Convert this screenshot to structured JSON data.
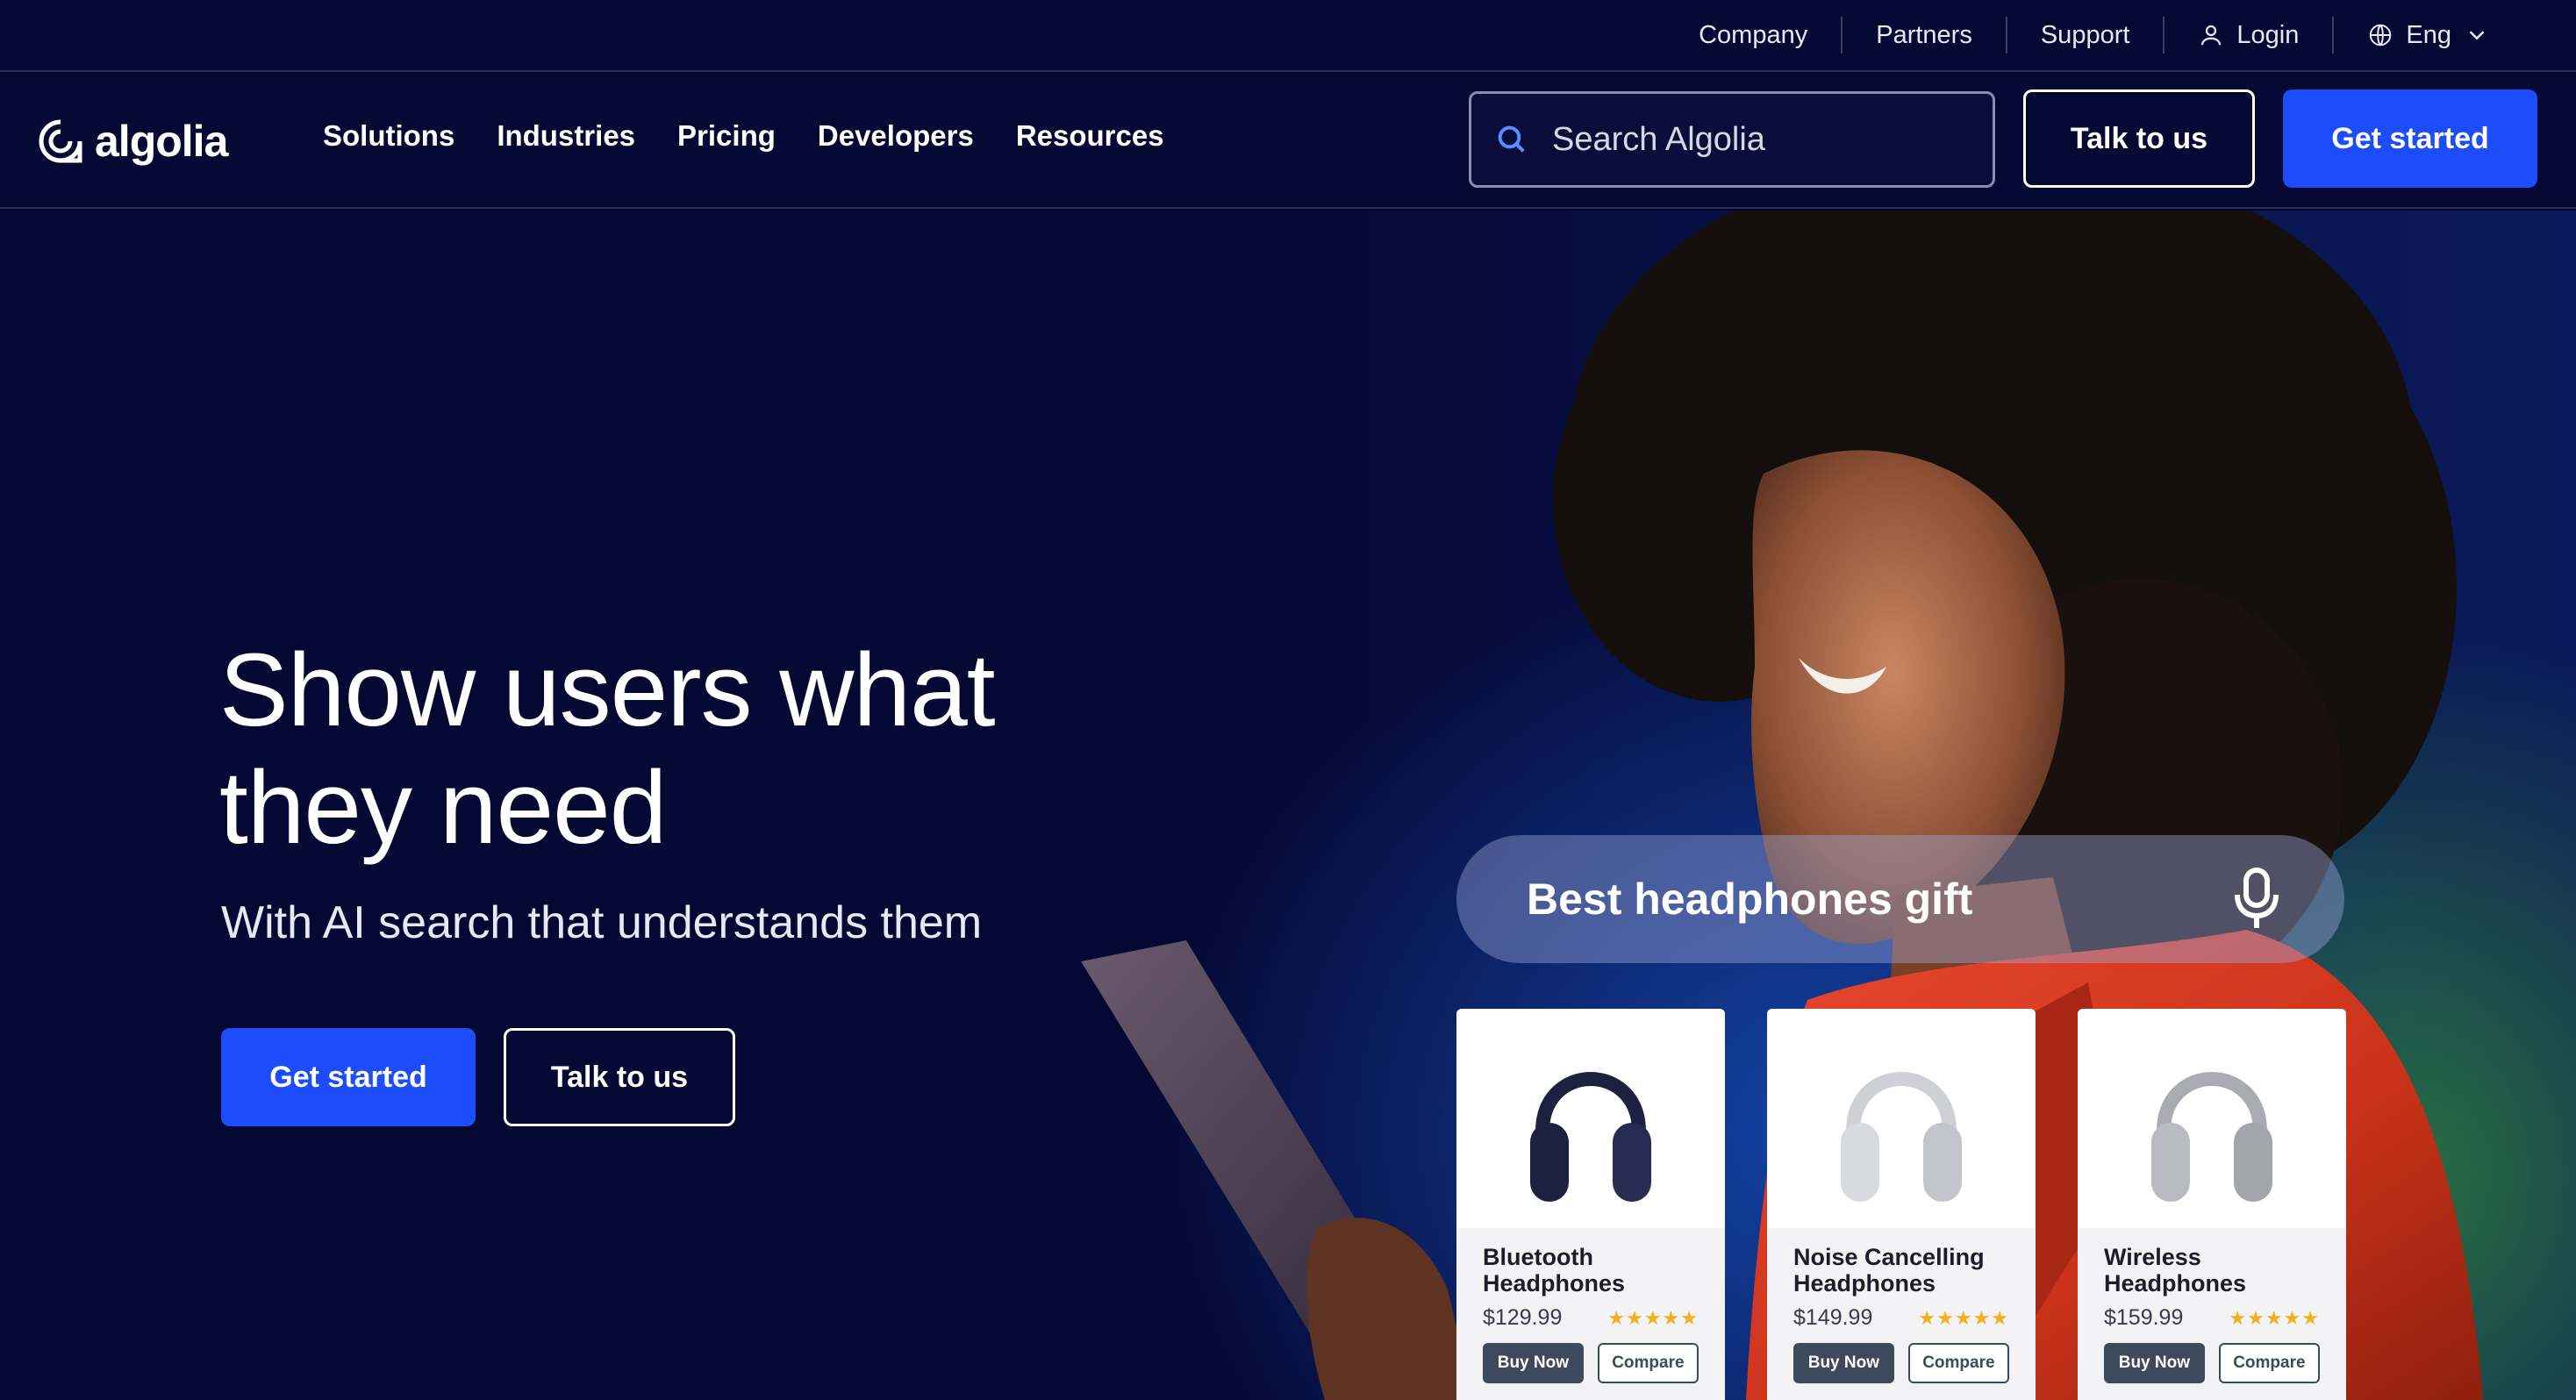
{
  "utility_nav": {
    "company": "Company",
    "partners": "Partners",
    "support": "Support",
    "login": "Login",
    "language": "Eng"
  },
  "brand": {
    "logo_text": "algolia"
  },
  "main_nav": {
    "links": [
      "Solutions",
      "Industries",
      "Pricing",
      "Developers",
      "Resources"
    ],
    "search_placeholder": "Search Algolia",
    "talk_label": "Talk to us",
    "start_label": "Get started"
  },
  "hero": {
    "title_line1": "Show users what",
    "title_line2": "they need",
    "subtitle": "With AI search that understands them",
    "start_label": "Get started",
    "talk_label": "Talk to us"
  },
  "voice_search": {
    "query": "Best headphones gift",
    "icon": "microphone-icon"
  },
  "products": [
    {
      "name": "Bluetooth Headphones",
      "price": "$129.99",
      "rating": 5,
      "color": "#1c2140",
      "buy": "Buy Now",
      "compare": "Compare"
    },
    {
      "name": "Noise Cancelling Headphones",
      "price": "$149.99",
      "rating": 5,
      "color": "#d9dade",
      "buy": "Buy Now",
      "compare": "Compare"
    },
    {
      "name": "Wireless Headphones",
      "price": "$159.99",
      "rating": 5,
      "color": "#b9bbc1",
      "buy": "Buy Now",
      "compare": "Compare"
    }
  ],
  "colors": {
    "background": "#050833",
    "accent": "#1d4dfa",
    "star": "#f2b01e",
    "card_button": "#3d4a5c"
  }
}
